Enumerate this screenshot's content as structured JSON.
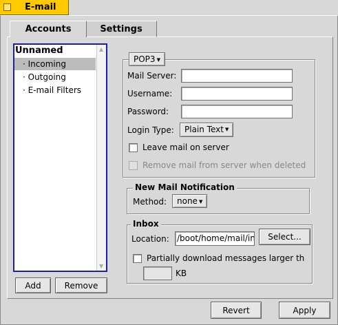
{
  "window": {
    "title": "E-mail"
  },
  "tabs": [
    {
      "label": "Accounts"
    },
    {
      "label": "Settings"
    }
  ],
  "accounts": {
    "root": "Unnamed",
    "items": [
      {
        "label": "· Incoming"
      },
      {
        "label": "· Outgoing"
      },
      {
        "label": "· E-mail Filters"
      }
    ],
    "add_label": "Add",
    "remove_label": "Remove"
  },
  "incoming": {
    "protocol": "POP3",
    "mail_server_label": "Mail Server:",
    "mail_server_value": "",
    "username_label": "Username:",
    "username_value": "",
    "password_label": "Password:",
    "password_value": "",
    "login_type_label": "Login Type:",
    "login_type_value": "Plain Text",
    "leave_mail_label": "Leave mail on server",
    "remove_mail_label": "Remove mail from server when deleted"
  },
  "notification": {
    "title": "New Mail Notification",
    "method_label": "Method:",
    "method_value": "none"
  },
  "inbox": {
    "title": "Inbox",
    "location_label": "Location:",
    "location_value": "/boot/home/mail/in",
    "select_label": "Select...",
    "partial_label": "Partially download messages larger th",
    "size_value": "",
    "kb_label": "KB"
  },
  "footer": {
    "revert_label": "Revert",
    "apply_label": "Apply"
  }
}
